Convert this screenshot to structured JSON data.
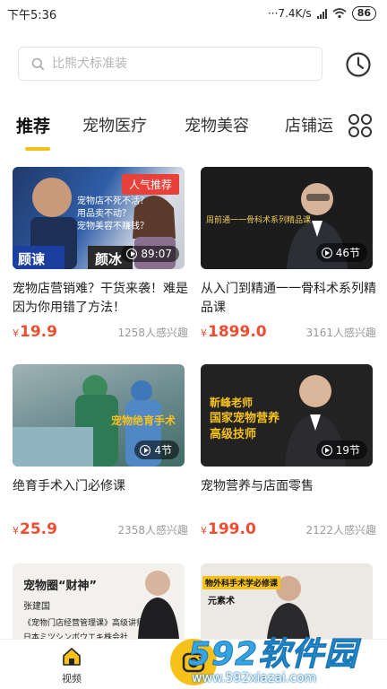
{
  "status_bar": {
    "time": "下午5:36",
    "network_speed": "···7.4K/s",
    "battery": "86"
  },
  "search": {
    "placeholder": "比熊犬标准装"
  },
  "tabs": [
    {
      "label": "推荐",
      "active": true
    },
    {
      "label": "宠物医疗",
      "active": false
    },
    {
      "label": "宠物美容",
      "active": false
    },
    {
      "label": "店铺运",
      "active": false
    }
  ],
  "courses": [
    {
      "title": "宠物店营销难？干货来袭！难是因为你用错了方法！",
      "price": "19.9",
      "currency": "¥",
      "interest": "1258人感兴趣",
      "badge": "89:07",
      "tag": "人气推荐",
      "thumb_text": {
        "l1": "宠物店不死不活？",
        "l2": "用品卖不动？",
        "l3": "宠物美容不赚钱？",
        "name1": "顾谏",
        "name2": "颜冰"
      }
    },
    {
      "title": "从入门到精通一一骨科术系列精品课",
      "price": "1899.0",
      "currency": "¥",
      "interest": "3161人感兴趣",
      "badge": "46节",
      "thumb_text": {
        "l1": "周前通一一骨科术系列精品课"
      }
    },
    {
      "title": "绝育手术入门必修课",
      "price": "25.9",
      "currency": "¥",
      "interest": "2358人感兴趣",
      "badge": "4节",
      "thumb_text": {
        "l1": "宠物绝育手术"
      }
    },
    {
      "title": "宠物营养与店面零售",
      "price": "199.0",
      "currency": "¥",
      "interest": "2122人感兴趣",
      "badge": "19节",
      "thumb_text": {
        "l1": "靳峰老师",
        "l2": "国家宠物营养",
        "l3": "高级技师"
      }
    },
    {
      "thumb_text": {
        "l1": "宠物圈“财神”",
        "l2": "张建国",
        "l3": "《宠物门店经营管理课》高级讲师",
        "l4": "日本ミツシンボウエキ株会社"
      }
    },
    {
      "thumb_text": {
        "l1": "物外科手术学必修课",
        "l2": "元素术"
      }
    }
  ],
  "bottom_nav": {
    "video_label": "视频"
  },
  "watermark": {
    "brand": "592软件园",
    "url": "www.592xiazai.com"
  },
  "colors": {
    "accent": "#f6c21a",
    "price": "#ef4d32",
    "tag_red": "#e8413a"
  }
}
